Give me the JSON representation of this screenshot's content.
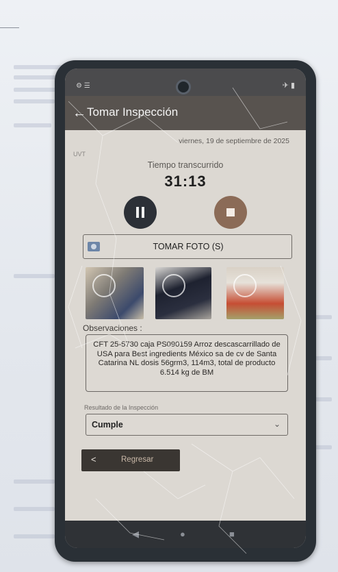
{
  "status_bar": {
    "left_text": "⚙ ☰",
    "right_text": "✈ ▮"
  },
  "app_bar": {
    "back_icon": "arrow-left",
    "title": "Tomar Inspección"
  },
  "date": "viernes, 19 de septiembre de 2025",
  "uv_label": "UVT",
  "timer": {
    "label": "Tiempo transcurrido",
    "value": "31:13"
  },
  "photo_button": {
    "label": "TOMAR FOTO (S)",
    "icon": "camera-icon"
  },
  "thumbnails": [
    "photo-1",
    "photo-2",
    "photo-3"
  ],
  "observations": {
    "label": "Observaciones :",
    "text": "CFT 25-5730 caja PS090159 Arroz descascarrillado de USA para Best ingredients México sa de cv de Santa Catarina NL dosis 56grm3, 114m3, total de producto 6.514 kg de BM"
  },
  "result": {
    "label": "Resultado de la Inspección",
    "value": "Cumple"
  },
  "back_button": {
    "label": "Regresar",
    "arrow": "<"
  },
  "nav": {
    "back": "◀",
    "home": "●",
    "recents": "■"
  },
  "colors": {
    "app_bar": "#58534f",
    "stop_button": "#8b6b57",
    "pause_button": "#2c3037"
  }
}
